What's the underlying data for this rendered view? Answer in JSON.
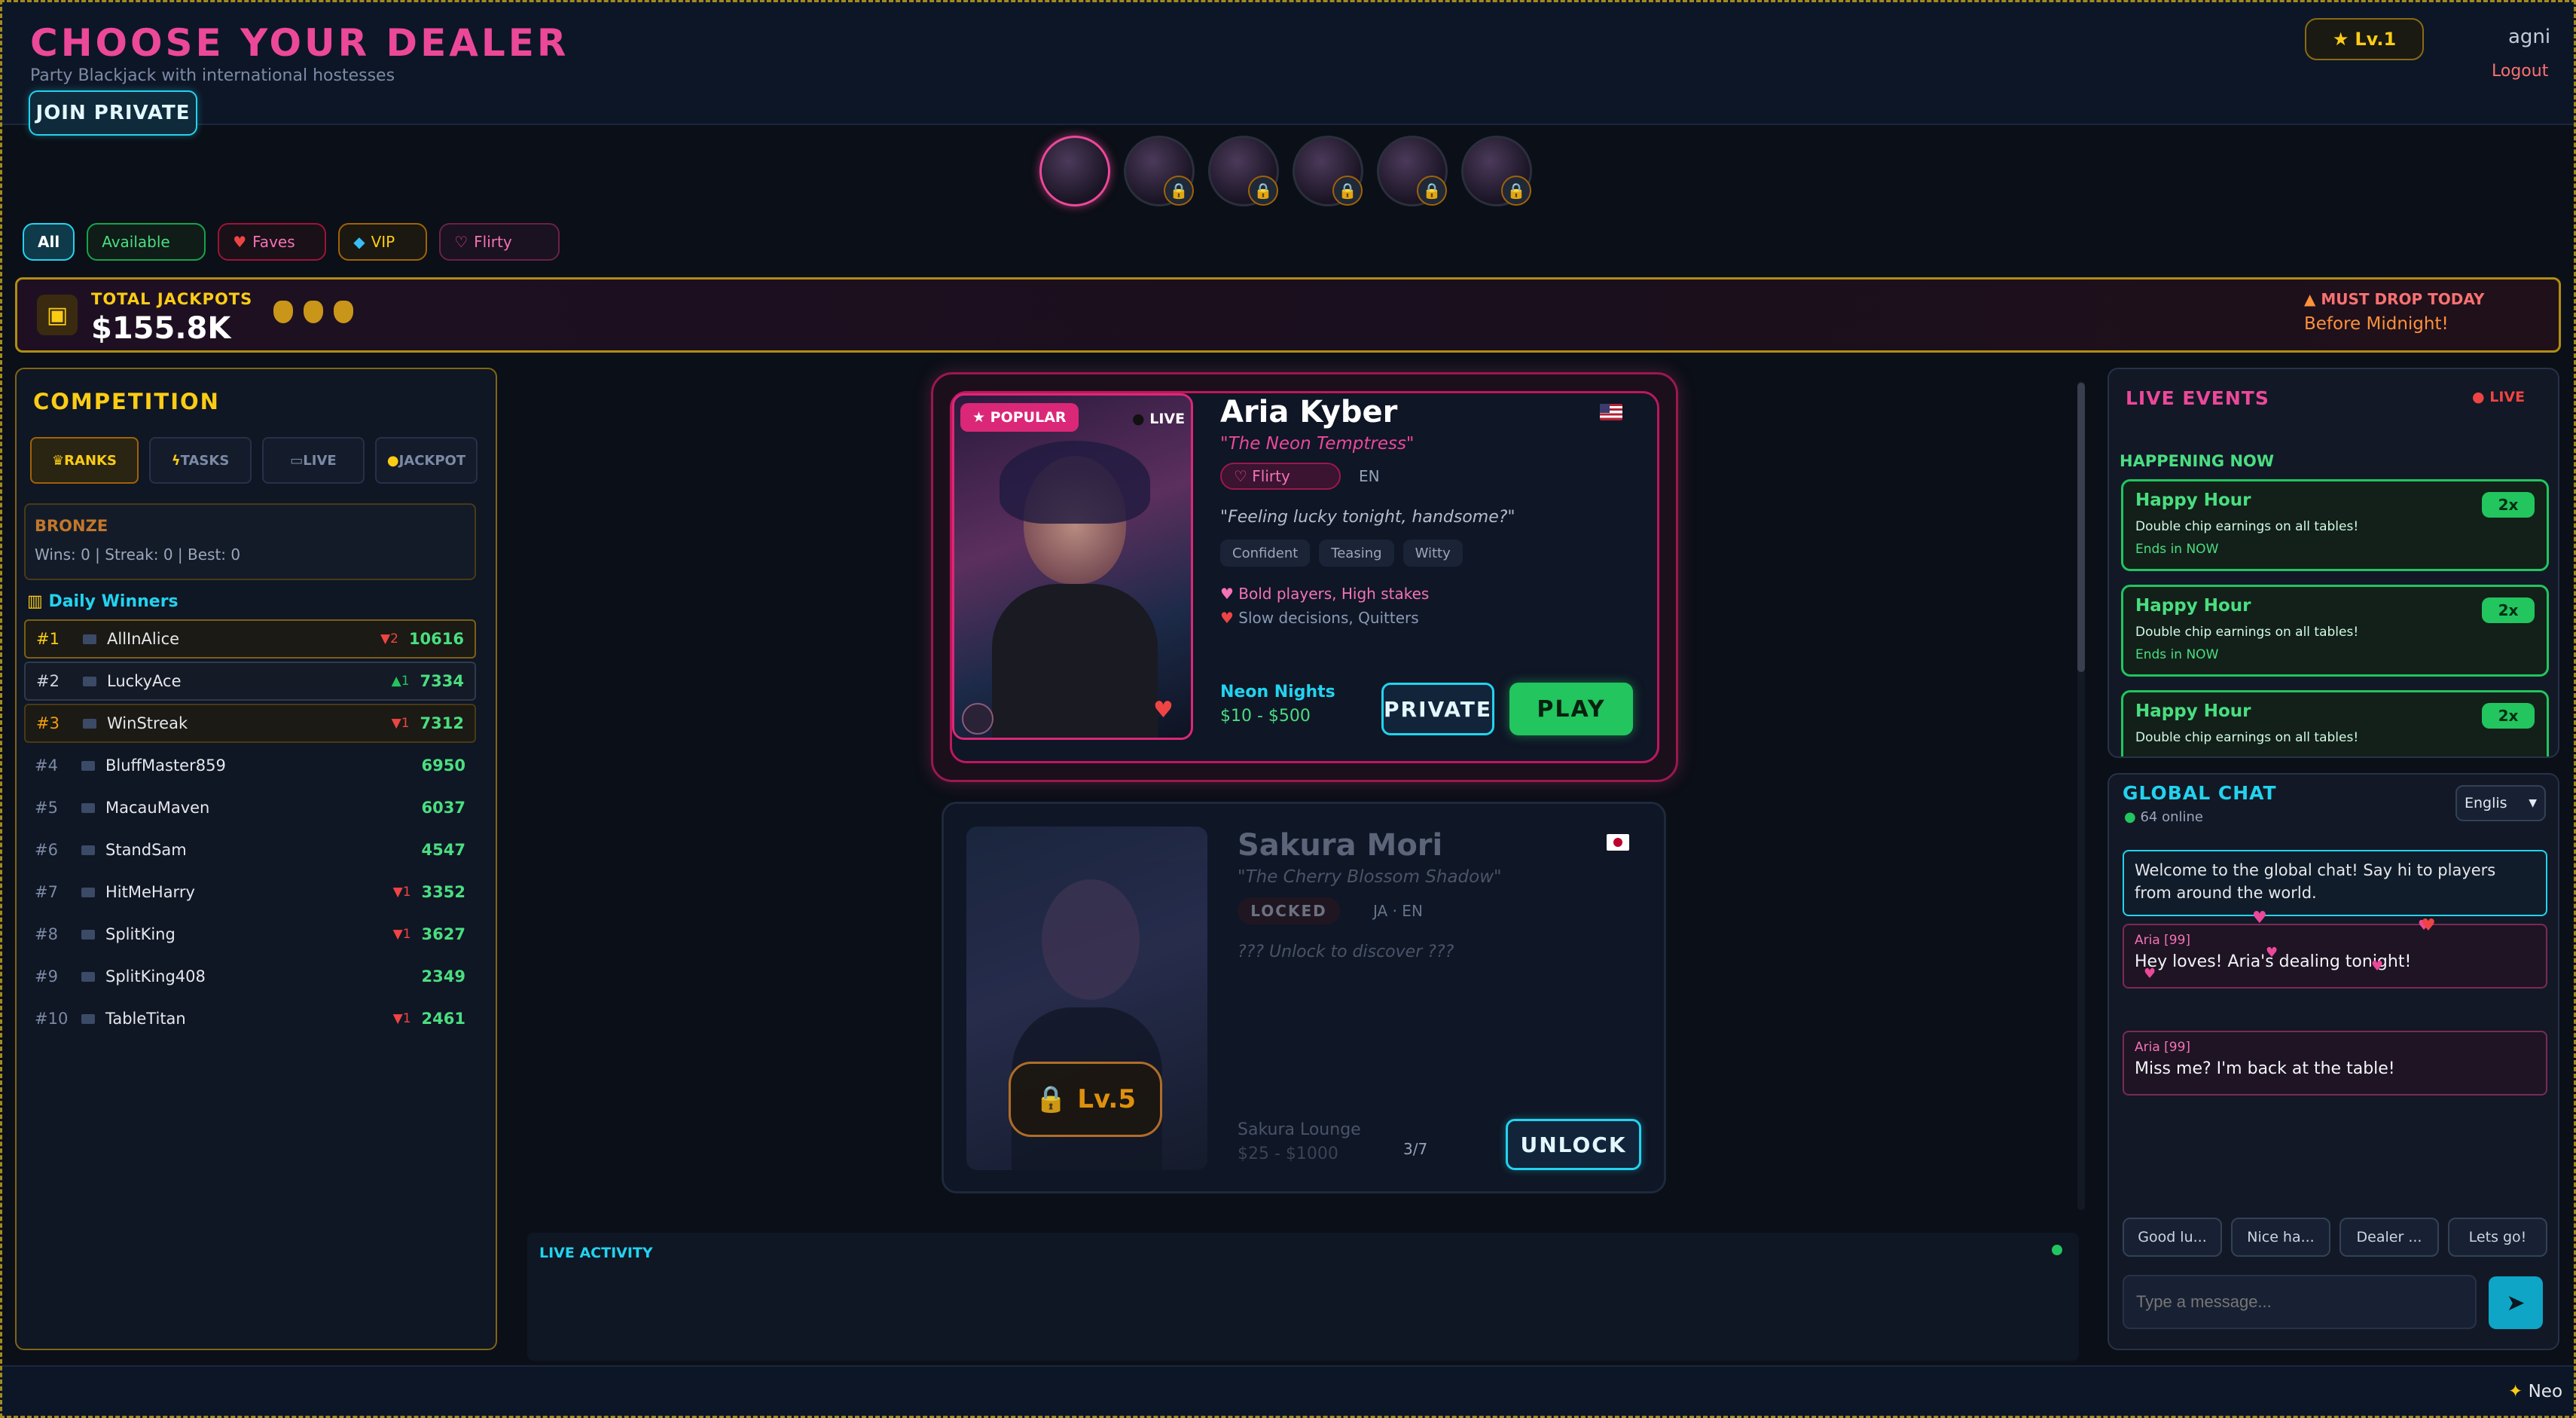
{
  "header": {
    "title": "CHOOSE YOUR DEALER",
    "subtitle": "Party Blackjack with international hostesses",
    "join_private": "JOIN PRIVATE",
    "level": "Lv.1",
    "username": "agni",
    "logout": "Logout"
  },
  "filters": [
    {
      "label": "All"
    },
    {
      "label": "Available"
    },
    {
      "label": "Faves"
    },
    {
      "label": "VIP"
    },
    {
      "label": "Flirty"
    }
  ],
  "jackpot": {
    "label": "TOTAL JACKPOTS",
    "amount": "$155.8K",
    "must_drop": "MUST DROP TODAY",
    "before": "Before Midnight!"
  },
  "competition": {
    "title": "COMPETITION",
    "tabs": [
      "RANKS",
      "TASKS",
      "LIVE",
      "JACKPOT"
    ],
    "tier": "BRONZE",
    "stats": "Wins: 0 | Streak: 0 | Best: 0",
    "daily_winners": "Daily Winners",
    "rows": [
      {
        "rank": "#1",
        "name": "AllInAlice",
        "change": "2",
        "dir": "down",
        "score": "10616"
      },
      {
        "rank": "#2",
        "name": "LuckyAce",
        "change": "1",
        "dir": "up",
        "score": "7334"
      },
      {
        "rank": "#3",
        "name": "WinStreak",
        "change": "1",
        "dir": "down",
        "score": "7312"
      },
      {
        "rank": "#4",
        "name": "BluffMaster859",
        "change": "",
        "dir": "",
        "score": "6950"
      },
      {
        "rank": "#5",
        "name": "MacauMaven",
        "change": "",
        "dir": "",
        "score": "6037"
      },
      {
        "rank": "#6",
        "name": "StandSam",
        "change": "",
        "dir": "",
        "score": "4547"
      },
      {
        "rank": "#7",
        "name": "HitMeHarry",
        "change": "1",
        "dir": "down",
        "score": "3352"
      },
      {
        "rank": "#8",
        "name": "SplitKing",
        "change": "1",
        "dir": "down",
        "score": "3627"
      },
      {
        "rank": "#9",
        "name": "SplitKing408",
        "change": "",
        "dir": "",
        "score": "2349"
      },
      {
        "rank": "#10",
        "name": "TableTitan",
        "change": "1",
        "dir": "down",
        "score": "2461"
      }
    ]
  },
  "dealer1": {
    "badge": "POPULAR",
    "live": "LIVE",
    "name": "Aria Kyber",
    "tagline": "\"The Neon Temptress\"",
    "mood": "Flirty",
    "lang": "EN",
    "quote": "\"Feeling lucky tonight, handsome?\"",
    "traits": [
      "Confident",
      "Teasing",
      "Witty"
    ],
    "likes": "Bold players, High stakes",
    "dislikes": "Slow decisions, Quitters",
    "table": "Neon Nights",
    "limits": "$10 - $500",
    "private": "PRIVATE",
    "play": "PLAY"
  },
  "dealer2": {
    "name": "Sakura Mori",
    "tagline": "\"The Cherry Blossom Shadow\"",
    "status": "LOCKED",
    "lang": "JA · EN",
    "hint": "??? Unlock to discover ???",
    "level": "Lv.5",
    "table": "Sakura Lounge",
    "limits": "$25 - $1000",
    "progress": "3/7",
    "unlock": "UNLOCK"
  },
  "activity": {
    "title": "LIVE ACTIVITY"
  },
  "events": {
    "title": "LIVE EVENTS",
    "live": "LIVE",
    "section": "HAPPENING NOW",
    "items": [
      {
        "title": "Happy Hour",
        "desc": "Double chip earnings on all tables!",
        "ends": "Ends in NOW",
        "mult": "2x"
      },
      {
        "title": "Happy Hour",
        "desc": "Double chip earnings on all tables!",
        "ends": "Ends in NOW",
        "mult": "2x"
      },
      {
        "title": "Happy Hour",
        "desc": "Double chip earnings on all tables!",
        "ends": "",
        "mult": "2x"
      }
    ]
  },
  "chat": {
    "title": "GLOBAL CHAT",
    "online": "64 online",
    "language": "Englis",
    "welcome": "Welcome to the global chat! Say hi to players from around the world.",
    "messages": [
      {
        "user": "Aria [99]",
        "text": "Hey loves! Aria's dealing tonight!"
      },
      {
        "user": "Aria [99]",
        "text": "Miss me? I'm back at the table!"
      }
    ],
    "quick": [
      "Good lu...",
      "Nice ha...",
      "Dealer ...",
      "Lets go!"
    ],
    "placeholder": "Type a message..."
  },
  "ticker": "Neo"
}
